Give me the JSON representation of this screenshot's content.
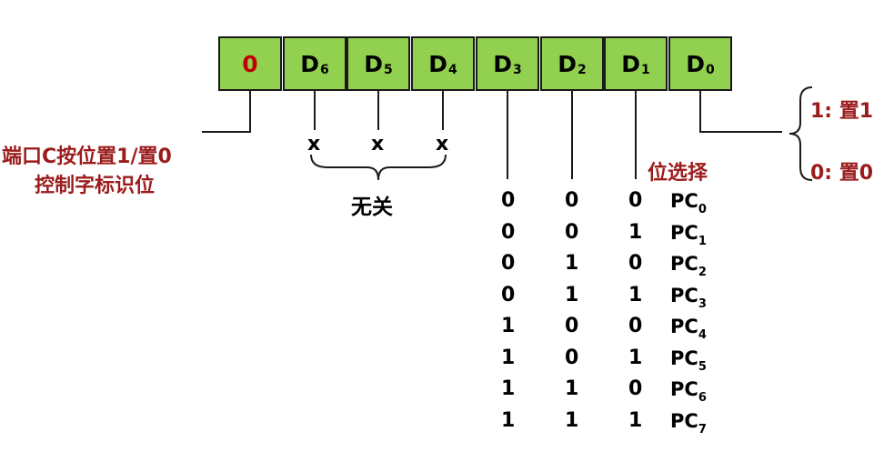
{
  "register": {
    "cells": [
      {
        "main": "0",
        "sub": ""
      },
      {
        "main": "D",
        "sub": "6"
      },
      {
        "main": "D",
        "sub": "5"
      },
      {
        "main": "D",
        "sub": "4"
      },
      {
        "main": "D",
        "sub": "3"
      },
      {
        "main": "D",
        "sub": "2"
      },
      {
        "main": "D",
        "sub": "1"
      },
      {
        "main": "D",
        "sub": "0"
      }
    ]
  },
  "labels": {
    "flag_line1": "端口C按位置1/置0",
    "flag_line2": "控制字标识位",
    "dont_care_mark": "x",
    "dont_care": "无关",
    "bit_select": "位选择",
    "set1": "1: 置1",
    "set0": "0: 置0"
  },
  "bit_table": {
    "rows": [
      {
        "d3": "0",
        "d2": "0",
        "d1": "0",
        "pc": "PC",
        "sub": "0"
      },
      {
        "d3": "0",
        "d2": "0",
        "d1": "1",
        "pc": "PC",
        "sub": "1"
      },
      {
        "d3": "0",
        "d2": "1",
        "d1": "0",
        "pc": "PC",
        "sub": "2"
      },
      {
        "d3": "0",
        "d2": "1",
        "d1": "1",
        "pc": "PC",
        "sub": "3"
      },
      {
        "d3": "1",
        "d2": "0",
        "d1": "0",
        "pc": "PC",
        "sub": "4"
      },
      {
        "d3": "1",
        "d2": "0",
        "d1": "1",
        "pc": "PC",
        "sub": "5"
      },
      {
        "d3": "1",
        "d2": "1",
        "d1": "0",
        "pc": "PC",
        "sub": "6"
      },
      {
        "d3": "1",
        "d2": "1",
        "d1": "1",
        "pc": "PC",
        "sub": "7"
      }
    ]
  },
  "colors": {
    "cell_fill": "#92d050",
    "accent_red": "#9b1c1c",
    "zero_red": "#c00000",
    "line": "#1a1a1a"
  }
}
